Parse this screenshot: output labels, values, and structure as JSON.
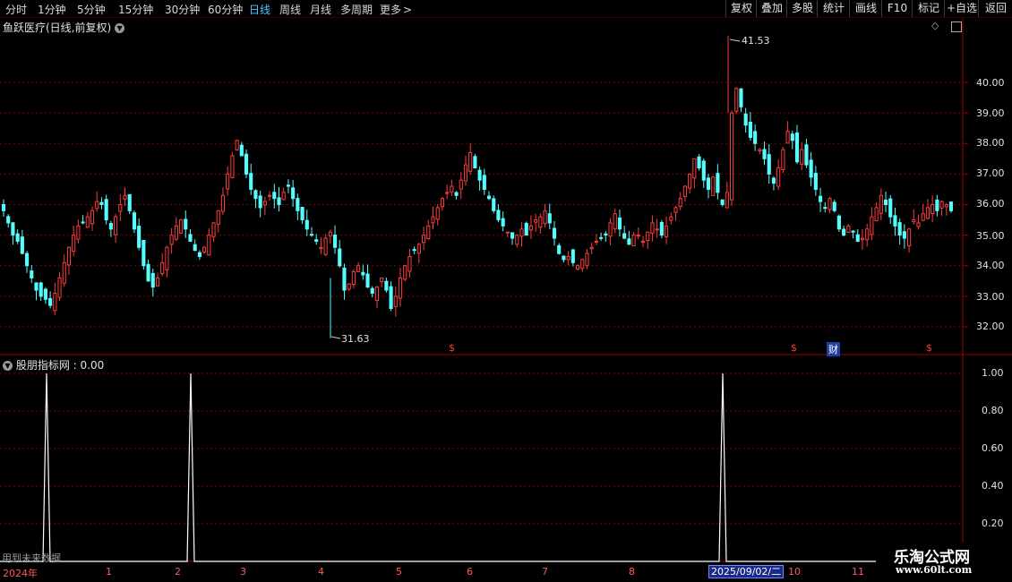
{
  "toolbar": {
    "periods": [
      "分时",
      "1分钟",
      "5分钟",
      "15分钟",
      "30分钟",
      "60分钟",
      "日线",
      "周线",
      "月线",
      "多周期",
      "更多"
    ],
    "active_period": "日线",
    "more_arrow": ">",
    "right_buttons": [
      "复权",
      "叠加",
      "多股",
      "统计",
      "画线",
      "F10",
      "标记",
      "+自选",
      "返回"
    ]
  },
  "stock": {
    "title": "鱼跃医疗(日线,前复权)",
    "high_label": "41.53",
    "low_label": "31.63",
    "event_markers": [
      "$",
      "$",
      "$"
    ],
    "finance_marker": "财"
  },
  "indicator": {
    "title": "股朋指标网 : 0.00",
    "future_note": "用到未来数据",
    "signal_value": "1.00"
  },
  "price_axis": [
    "40.00",
    "39.00",
    "38.00",
    "37.00",
    "36.00",
    "35.00",
    "34.00",
    "33.00",
    "32.00"
  ],
  "indicator_axis": [
    "1.00",
    "0.80",
    "0.60",
    "0.40",
    "0.20"
  ],
  "time_axis": [
    "2024年",
    "1",
    "2",
    "3",
    "4",
    "5",
    "6",
    "7",
    "8",
    "2025/09/02/二",
    "10",
    "11"
  ],
  "watermark": {
    "name": "乐淘公式网",
    "site": "www.60lt.com"
  },
  "colors": {
    "up": "#ff3b3b",
    "down": "#54ffff",
    "grid": "#8a0000",
    "active": "#4fc8ff"
  },
  "chart_data": {
    "type": "candlestick",
    "ylim": [
      31.5,
      42.0
    ],
    "closes": [
      35.8,
      35.4,
      35.0,
      34.8,
      34.4,
      34.0,
      33.6,
      33.2,
      33.0,
      32.9,
      32.7,
      33.1,
      33.6,
      34.1,
      34.6,
      35.0,
      35.3,
      35.4,
      35.6,
      35.8,
      36.1,
      36.0,
      35.5,
      35.2,
      35.6,
      36.0,
      36.3,
      35.8,
      35.2,
      34.6,
      34.0,
      33.5,
      33.3,
      33.6,
      34.1,
      34.6,
      35.0,
      35.3,
      35.5,
      35.2,
      34.8,
      34.5,
      34.3,
      34.6,
      35.0,
      35.4,
      35.8,
      36.3,
      37.0,
      37.6,
      38.1,
      37.6,
      37.0,
      36.5,
      36.2,
      35.9,
      36.1,
      36.3,
      36.2,
      36.0,
      36.4,
      36.6,
      36.2,
      35.8,
      35.5,
      35.2,
      35.0,
      34.8,
      34.6,
      34.9,
      35.1,
      34.6,
      34.0,
      33.2,
      33.4,
      33.8,
      34.0,
      33.7,
      33.3,
      33.1,
      33.3,
      33.6,
      33.2,
      32.6,
      33.0,
      33.6,
      34.0,
      34.3,
      34.5,
      34.7,
      35.0,
      35.3,
      35.6,
      35.9,
      36.2,
      36.4,
      36.6,
      36.3,
      36.8,
      37.3,
      37.7,
      37.2,
      36.8,
      36.5,
      36.2,
      35.8,
      35.5,
      35.3,
      35.1,
      34.9,
      35.0,
      35.2,
      35.0,
      35.3,
      35.5,
      35.6,
      35.8,
      35.4,
      34.9,
      34.4,
      34.2,
      34.3,
      34.1,
      34.0,
      34.2,
      34.4,
      34.6,
      34.8,
      34.9,
      35.0,
      35.4,
      35.7,
      35.2,
      34.9,
      34.7,
      35.0,
      35.0,
      34.8,
      35.1,
      35.4,
      35.2,
      35.0,
      35.3,
      35.6,
      35.9,
      36.2,
      36.6,
      37.0,
      37.5,
      37.2,
      36.8,
      36.5,
      36.9,
      36.4,
      36.0,
      36.4,
      39.0,
      39.8,
      39.2,
      38.6,
      38.2,
      38.0,
      37.8,
      37.5,
      37.0,
      36.7,
      37.2,
      37.8,
      38.4,
      38.1,
      37.4,
      37.8,
      37.3,
      36.9,
      36.5,
      36.1,
      35.9,
      36.2,
      35.8,
      35.2,
      35.0,
      35.3,
      35.1,
      34.8,
      34.9,
      35.2,
      35.6,
      35.9,
      36.3,
      36.0,
      35.6,
      35.3,
      35.0,
      34.9,
      35.2,
      35.5,
      35.4,
      35.7,
      35.9,
      36.0,
      35.8,
      36.1,
      36.0,
      35.8
    ],
    "highs": [
      {
        "label": "41.53",
        "value": 41.53
      },
      {
        "label": "31.63",
        "value": 31.63
      }
    ],
    "indicator_signals": {
      "series": "股朋指标网",
      "values_at_peaks": [
        1.0,
        1.0,
        1.0
      ]
    }
  }
}
